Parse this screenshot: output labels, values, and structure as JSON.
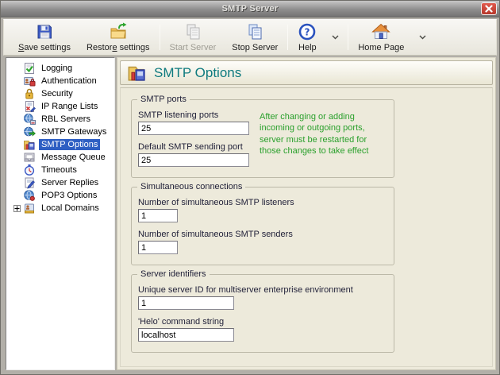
{
  "window": {
    "title": "SMTP Server"
  },
  "toolbar": {
    "groups": [
      {
        "buttons": [
          {
            "name": "save-settings",
            "label": "Save settings",
            "underline_index": 0,
            "icon": "floppy-disk-icon",
            "enabled": true,
            "dropdown": false
          },
          {
            "name": "restore-settings",
            "label": "Restore settings",
            "underline_index": 6,
            "icon": "restore-folder-icon",
            "enabled": true,
            "dropdown": false
          }
        ]
      },
      {
        "buttons": [
          {
            "name": "start-server",
            "label": "Start Server",
            "underline_index": -1,
            "icon": "start-server-icon",
            "enabled": false,
            "dropdown": false
          },
          {
            "name": "stop-server",
            "label": "Stop Server",
            "underline_index": -1,
            "icon": "stop-server-icon",
            "enabled": true,
            "dropdown": false
          }
        ]
      },
      {
        "buttons": [
          {
            "name": "help",
            "label": "Help",
            "underline_index": -1,
            "icon": "help-icon",
            "enabled": true,
            "dropdown": true
          }
        ]
      },
      {
        "buttons": [
          {
            "name": "home-page",
            "label": "Home Page",
            "underline_index": -1,
            "icon": "home-icon",
            "enabled": true,
            "dropdown": true
          }
        ]
      }
    ]
  },
  "sidebar": {
    "items": [
      {
        "label": "Logging",
        "icon": "logging-icon",
        "selected": false,
        "expandable": false
      },
      {
        "label": "Authentication",
        "icon": "authentication-icon",
        "selected": false,
        "expandable": false
      },
      {
        "label": "Security",
        "icon": "security-icon",
        "selected": false,
        "expandable": false
      },
      {
        "label": "IP Range Lists",
        "icon": "ip-range-lists-icon",
        "selected": false,
        "expandable": false
      },
      {
        "label": "RBL Servers",
        "icon": "rbl-servers-icon",
        "selected": false,
        "expandable": false
      },
      {
        "label": "SMTP Gateways",
        "icon": "smtp-gateways-icon",
        "selected": false,
        "expandable": false
      },
      {
        "label": "SMTP Options",
        "icon": "smtp-options-icon",
        "selected": true,
        "expandable": false
      },
      {
        "label": "Message Queue",
        "icon": "message-queue-icon",
        "selected": false,
        "expandable": false
      },
      {
        "label": "Timeouts",
        "icon": "timeouts-icon",
        "selected": false,
        "expandable": false
      },
      {
        "label": "Server Replies",
        "icon": "server-replies-icon",
        "selected": false,
        "expandable": false
      },
      {
        "label": "POP3 Options",
        "icon": "pop3-options-icon",
        "selected": false,
        "expandable": false
      },
      {
        "label": "Local Domains",
        "icon": "local-domains-icon",
        "selected": false,
        "expandable": true
      }
    ]
  },
  "main": {
    "header": {
      "title": "SMTP Options",
      "icon": "smtp-options-icon"
    },
    "groups": [
      {
        "title": "SMTP ports",
        "note": "After changing or adding incoming or outgoing ports, server must be restarted for those changes to take effect",
        "fields": [
          {
            "label": "SMTP listening ports",
            "value": "25",
            "size": "wide"
          },
          {
            "label": "Default SMTP sending port",
            "value": "25",
            "size": "wide"
          }
        ]
      },
      {
        "title": "Simultaneous connections",
        "note": "",
        "fields": [
          {
            "label": "Number of simultaneous SMTP listeners",
            "value": "1",
            "size": "narrow"
          },
          {
            "label": "Number of simultaneous SMTP senders",
            "value": "1",
            "size": "narrow"
          }
        ]
      },
      {
        "title": "Server identifiers",
        "note": "",
        "fields": [
          {
            "label": "Unique server ID for multiserver enterprise environment",
            "value": "1",
            "size": "medium"
          },
          {
            "label": "'Helo' command string",
            "value": "localhost",
            "size": "medium"
          }
        ]
      }
    ]
  },
  "colors": {
    "selection_blue": "#2e5fc3",
    "header_teal": "#0e7a7e",
    "note_green": "#2aa02c",
    "close_red": "#b6372b",
    "panel_cream": "#edeadb"
  }
}
